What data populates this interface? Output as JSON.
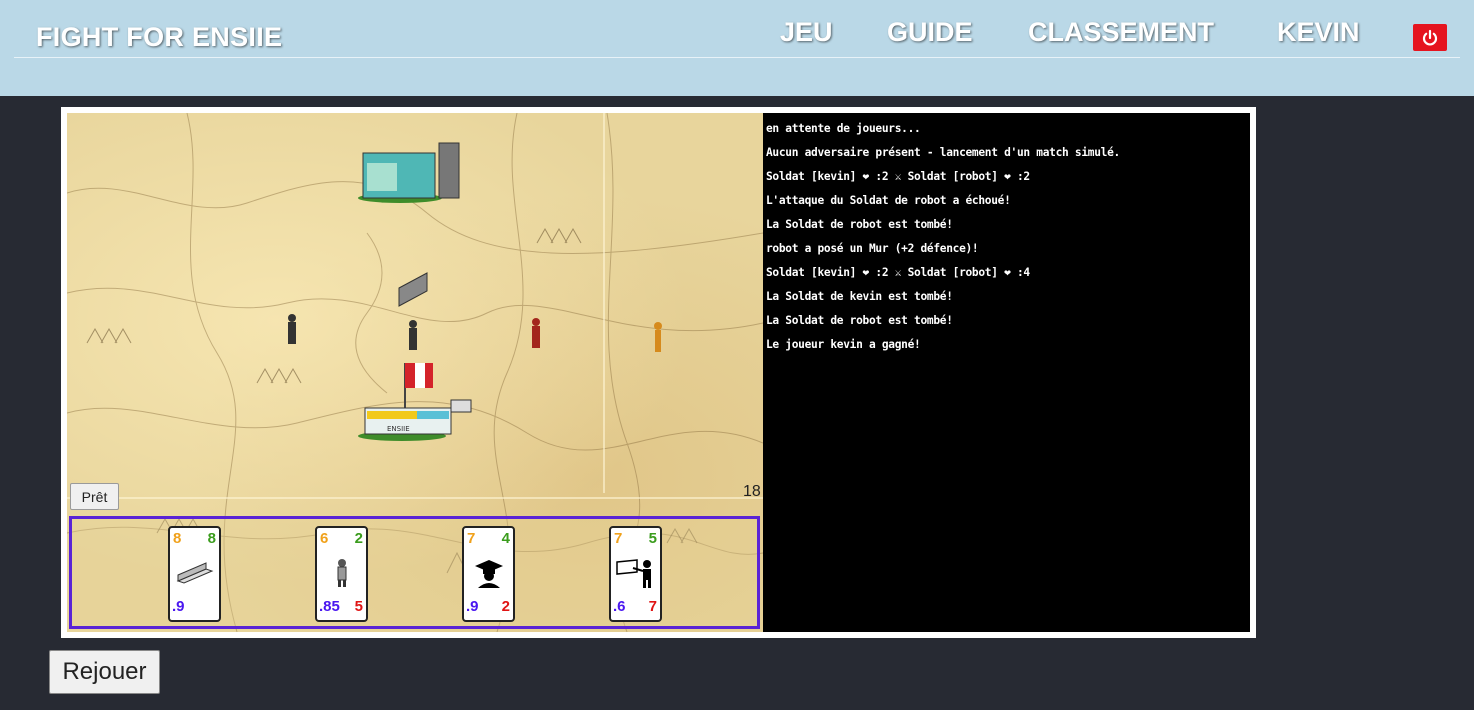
{
  "header": {
    "brand": "FIGHT FOR ENSIIE",
    "nav": [
      "JEU",
      "GUIDE",
      "CLASSEMENT",
      "KEVIN"
    ],
    "power_icon": "power-icon",
    "accent": "#bad8e7",
    "power_color": "#e5141f"
  },
  "game": {
    "ready_label": "Prêt",
    "timer": "18",
    "map_labels": {
      "building": "ENSIIE"
    },
    "log": [
      "en attente de joueurs...",
      "Aucun adversaire présent - lancement d'un match simulé.",
      "Soldat [kevin] ❤ :2 ⚔ Soldat [robot] ❤ :2",
      "L'attaque du Soldat de robot a échoué!",
      "La Soldat de robot est tombé!",
      "robot a posé un Mur (+2 défence)!",
      "Soldat [kevin] ❤ :2 ⚔ Soldat [robot] ❤ :4",
      "La Soldat de kevin est tombé!",
      "La Soldat de robot est tombé!",
      "Le joueur kevin a gagné!"
    ],
    "hand_border": "#5a23d6",
    "cards": [
      {
        "icon": "wall-icon",
        "tl": "8",
        "tr": "8",
        "bl": ".9",
        "br": ""
      },
      {
        "icon": "soldier-icon",
        "tl": "6",
        "tr": "2",
        "bl": ".85",
        "br": "5"
      },
      {
        "icon": "graduate-icon",
        "tl": "7",
        "tr": "4",
        "bl": ".9",
        "br": "2"
      },
      {
        "icon": "teacher-icon",
        "tl": "7",
        "tr": "5",
        "bl": ".6",
        "br": "7"
      }
    ]
  },
  "footer": {
    "replay_label": "Rejouer"
  }
}
